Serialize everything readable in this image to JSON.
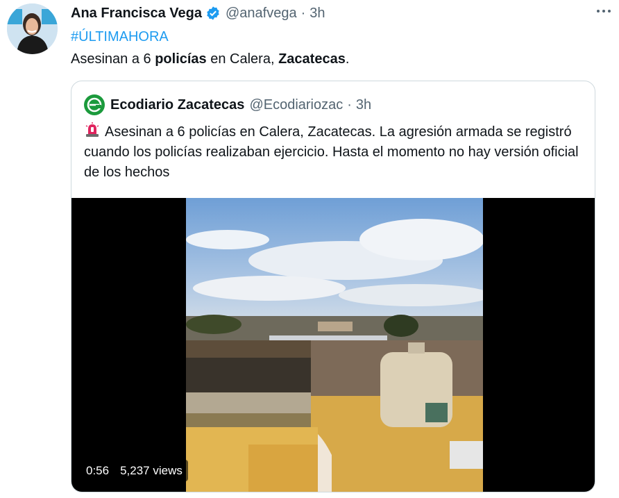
{
  "tweet": {
    "author_name": "Ana Francisca Vega",
    "handle": "@anafvega",
    "separator": "·",
    "time": "3h",
    "hashtag": "#ÚLTIMAHORA",
    "text_before": "Asesinan a 6 ",
    "text_bold1": "policías",
    "text_mid": " en Calera, ",
    "text_bold2": "Zacatecas",
    "text_after": ".",
    "verified_icon": "verified-badge-icon",
    "more_icon": "more-options-icon"
  },
  "quoted": {
    "author_name": "Ecodiario Zacatecas",
    "handle": "@Ecodiariozac",
    "separator": "·",
    "time": "3h",
    "text": "Asesinan a 6 policías en Calera, Zacatecas. La agresión armada se registró cuando los policías realizaban ejercicio. Hasta el momento no hay versión oficial de los hechos",
    "emoji_icon": "police-siren-icon"
  },
  "media": {
    "duration": "0:56",
    "views": "5,237 views"
  },
  "colors": {
    "link": "#1d9bf0",
    "secondary_text": "#536471",
    "border": "#cfd9de",
    "brand_green": "#1b9a3c"
  }
}
